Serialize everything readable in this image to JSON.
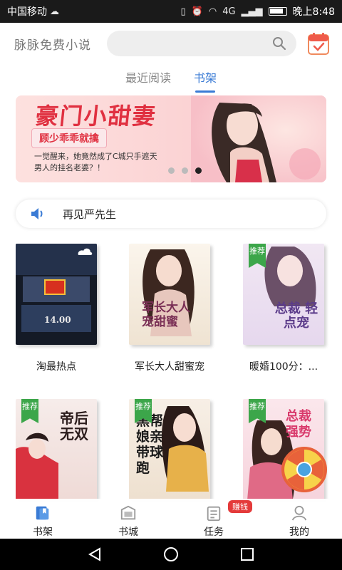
{
  "status": {
    "carrier": "中国移动",
    "time": "晚上8:48",
    "net": "4G"
  },
  "header": {
    "title": "脉脉免费小说",
    "search": {
      "value": "",
      "placeholder": ""
    }
  },
  "tabs": [
    {
      "label": "最近阅读",
      "active": false
    },
    {
      "label": "书架",
      "active": true
    }
  ],
  "banner": {
    "title": "豪门小甜妻",
    "tag": "顾少乖乖就擒",
    "desc_line1": "一觉醒来，她竟然成了C城只手遮天",
    "desc_line2": "男人的挂名老婆？！",
    "slides": 3,
    "active_slide": 3
  },
  "notice": {
    "text": "再见严先生"
  },
  "books": [
    {
      "title": "淘最热点",
      "recommended": false,
      "cover_text": "14.00"
    },
    {
      "title": "军长大人甜蜜宠",
      "recommended": false,
      "cover_text": "军长大人 宠甜蜜"
    },
    {
      "title": "暖婚100分：...",
      "recommended": true,
      "cover_text": "总裁 轻点宠"
    },
    {
      "title": "",
      "recommended": true,
      "cover_text": "帝后无双"
    },
    {
      "title": "",
      "recommended": true,
      "cover_text": "黑帮 娘亲 带球 跑"
    },
    {
      "title": "",
      "recommended": true,
      "cover_text": "总裁 强势"
    }
  ],
  "recommend_label": "推荐",
  "bottom_nav": [
    {
      "label": "书架",
      "active": true
    },
    {
      "label": "书城",
      "active": false
    },
    {
      "label": "任务",
      "active": false,
      "badge": "赚钱"
    },
    {
      "label": "我的",
      "active": false
    }
  ],
  "colors": {
    "accent": "#3a7bd5",
    "tag_green": "#3ca64a",
    "badge_red": "#e43a3a",
    "banner_red": "#e03040"
  }
}
